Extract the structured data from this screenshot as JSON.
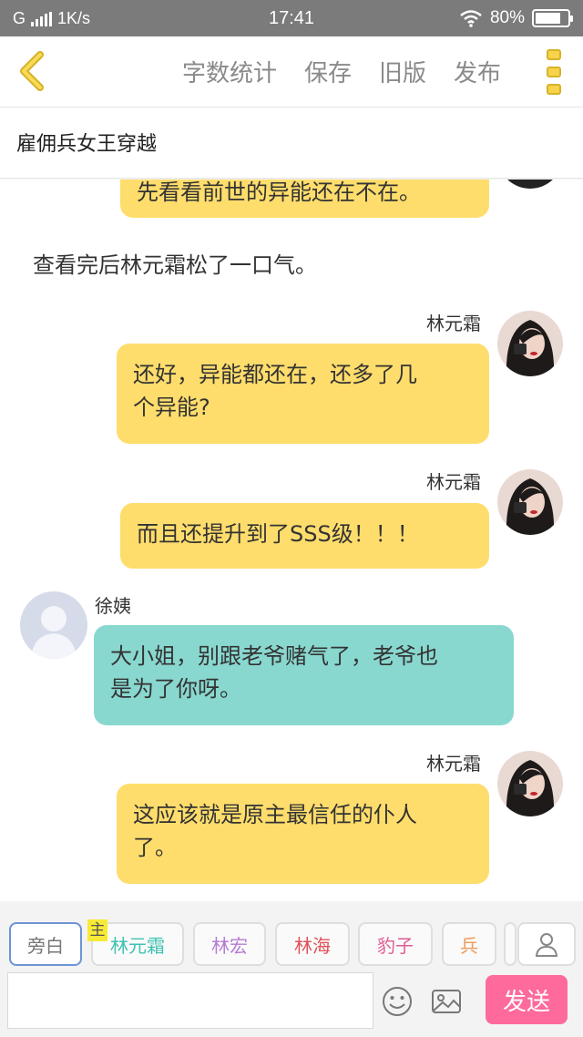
{
  "status": {
    "carrier": "G",
    "speed": "1K/s",
    "time": "17:41",
    "battery": "80%",
    "battery_level": 0.8
  },
  "toolbar": {
    "word_count": "字数统计",
    "save": "保存",
    "old_version": "旧版",
    "publish": "发布"
  },
  "story_title": "雇佣兵女王穿越",
  "messages": {
    "m0": {
      "text": "先看看前世的异能还在不在。"
    },
    "n1": {
      "text": "查看完后林元霜松了一口气。"
    },
    "m2": {
      "name": "林元霜",
      "line1": "还好，异能都还在，还多了几",
      "line2": "个异能?"
    },
    "m3": {
      "name": "林元霜",
      "text": "而且还提升到了SSS级！！！"
    },
    "m4": {
      "name": "徐姨",
      "line1": "大小姐，别跟老爷赌气了，老爷也",
      "line2": "是为了你呀。"
    },
    "m5": {
      "name": "林元霜",
      "line1": "这应该就是原主最信任的仆人",
      "line2": "了。"
    }
  },
  "roles": {
    "narrator": "旁白",
    "main_badge": "主",
    "r1": "林元霜",
    "r2": "林宏",
    "r3": "林海",
    "r4": "豹子",
    "r5": "兵"
  },
  "role_colors": {
    "r1": "#3fc1b3",
    "r2": "#b57ad6",
    "r3": "#e0525a",
    "r4": "#e05b95",
    "r5": "#f09a57"
  },
  "composer": {
    "send": "发送"
  }
}
